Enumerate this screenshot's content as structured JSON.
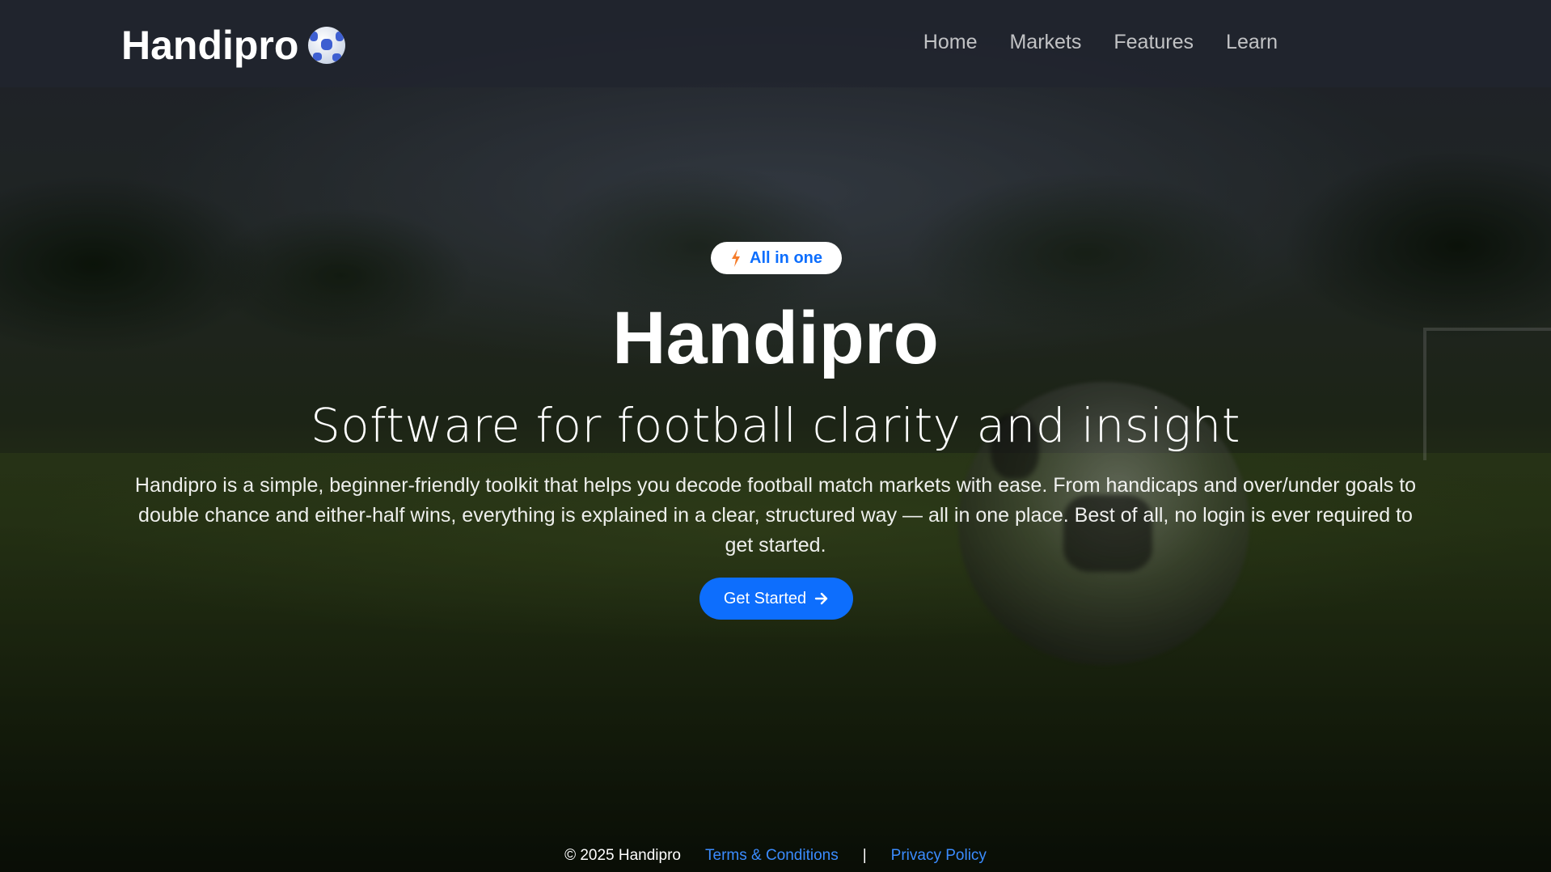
{
  "navbar": {
    "brand": "Handipro",
    "brand_icon": "soccer-ball-icon",
    "links": [
      "Home",
      "Markets",
      "Features",
      "Learn"
    ]
  },
  "hero": {
    "badge_icon": "lightning-bolt-icon",
    "badge_label": "All in one",
    "title": "Handipro",
    "subtitle": "Software for football clarity and insight",
    "description": "Handipro is a simple, beginner-friendly toolkit that helps you decode football match markets with ease. From handicaps and over/under goals to double chance and either-half wins, everything is explained in a clear, structured way — all in one place. Best of all, no login is ever required to get started.",
    "cta_label": "Get Started",
    "cta_icon": "arrow-right-icon"
  },
  "footer": {
    "copyright": "© 2025 Handipro",
    "terms": "Terms & Conditions",
    "separator": "|",
    "privacy": "Privacy Policy"
  },
  "colors": {
    "accent": "#0d6efd",
    "navbar_bg": "#21252e",
    "link": "#3b8cff",
    "bolt": "#f57c2a"
  }
}
